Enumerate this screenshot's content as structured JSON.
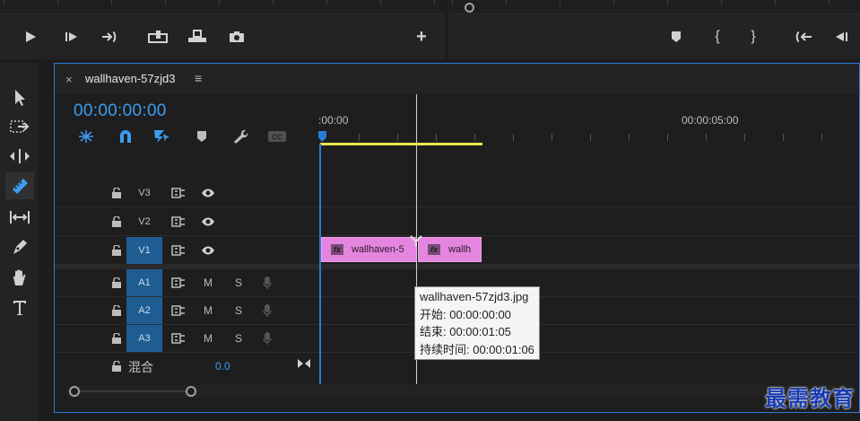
{
  "timeline": {
    "sequence_name": "wallhaven-57zjd3",
    "menu_glyph": "≡",
    "close_glyph": "×",
    "timecode": "00:00:00:00",
    "ruler": {
      "start_label": ":00:00",
      "label_5s": "00:00:05:00"
    },
    "tracks": {
      "video": [
        {
          "name": "V3",
          "targeted": false
        },
        {
          "name": "V2",
          "targeted": false
        },
        {
          "name": "V1",
          "targeted": true
        }
      ],
      "audio": [
        {
          "name": "A1",
          "targeted": true,
          "m": "M",
          "s": "S"
        },
        {
          "name": "A2",
          "targeted": true,
          "m": "M",
          "s": "S"
        },
        {
          "name": "A3",
          "targeted": true,
          "m": "M",
          "s": "S"
        }
      ]
    },
    "mix": {
      "label": "混合",
      "value": "0.0"
    },
    "clips": [
      {
        "fx": "fx",
        "label": "wallhaven-5"
      },
      {
        "fx": "fx",
        "label": "wallh"
      }
    ],
    "tooltip": {
      "title": "wallhaven-57zjd3.jpg",
      "start": "开始: 00:00:00:00",
      "end": "结束: 00:00:01:05",
      "duration": "持续时间: 00:00:01:06"
    }
  },
  "source_monitor": {
    "add_glyph": "+"
  },
  "program_monitor": {
    "mark_in_glyph": "{",
    "mark_out_glyph": "}"
  },
  "watermark": "最需教育",
  "colors": {
    "accent_blue": "#2a7ad5",
    "timecode_blue": "#3c9cf0",
    "clip_pink": "#e485e0",
    "work_area_yellow": "#e8e84a",
    "track_target": "#1f5c92"
  }
}
